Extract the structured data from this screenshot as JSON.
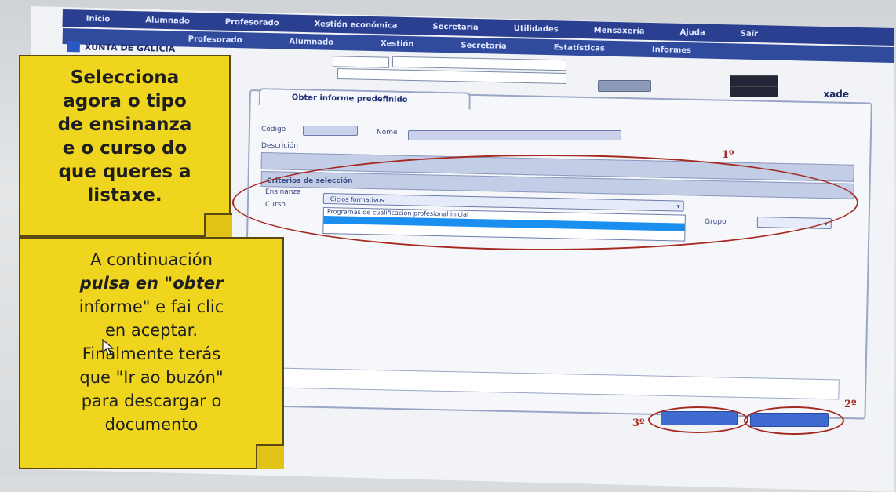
{
  "menu": {
    "top": [
      "Inicio",
      "Alumnado",
      "Profesorado",
      "Xestión económica",
      "Secretaría",
      "Utilidades",
      "Mensaxería",
      "Ajuda",
      "Saír"
    ],
    "sub": [
      "Profesorado",
      "Alumnado",
      "Xestión",
      "Secretaría",
      "Estatísticas",
      "Informes"
    ]
  },
  "brand": {
    "name": "XUNTA DE GALICIA"
  },
  "header": {
    "user": "xade"
  },
  "tab": {
    "label": "Obter informe predefinido"
  },
  "form": {
    "codigo_label": "Código",
    "nome_label": "Nome",
    "descricion_label": "Descrición",
    "criterios_label": "Criterios de selección",
    "ensinanza_label": "Ensinanza",
    "ensinanza_value": "Ciclos formativos",
    "curso_label": "Curso",
    "dropdown_option": "Programas de cualificación profesional inicial",
    "grupo_label": "Grupo"
  },
  "annotations": {
    "mark1": "1º",
    "mark2": "2º",
    "mark3": "3º"
  },
  "notes": {
    "note1": [
      "Selecciona",
      "agora o tipo",
      "de ensinanza",
      "e o curso do",
      "que queres a",
      "listaxe."
    ],
    "note2": [
      "A continuación",
      "pulsa en \"obter",
      "informe\" e fai clic",
      "en aceptar.",
      "Finalmente terás",
      "que \"Ir ao buzón\"",
      "para descargar o",
      "documento"
    ]
  },
  "colors": {
    "menu": "#2a3f8f",
    "note": "#f0d51f",
    "ellipse": "#a52a22",
    "selected": "#1b8ff0"
  }
}
